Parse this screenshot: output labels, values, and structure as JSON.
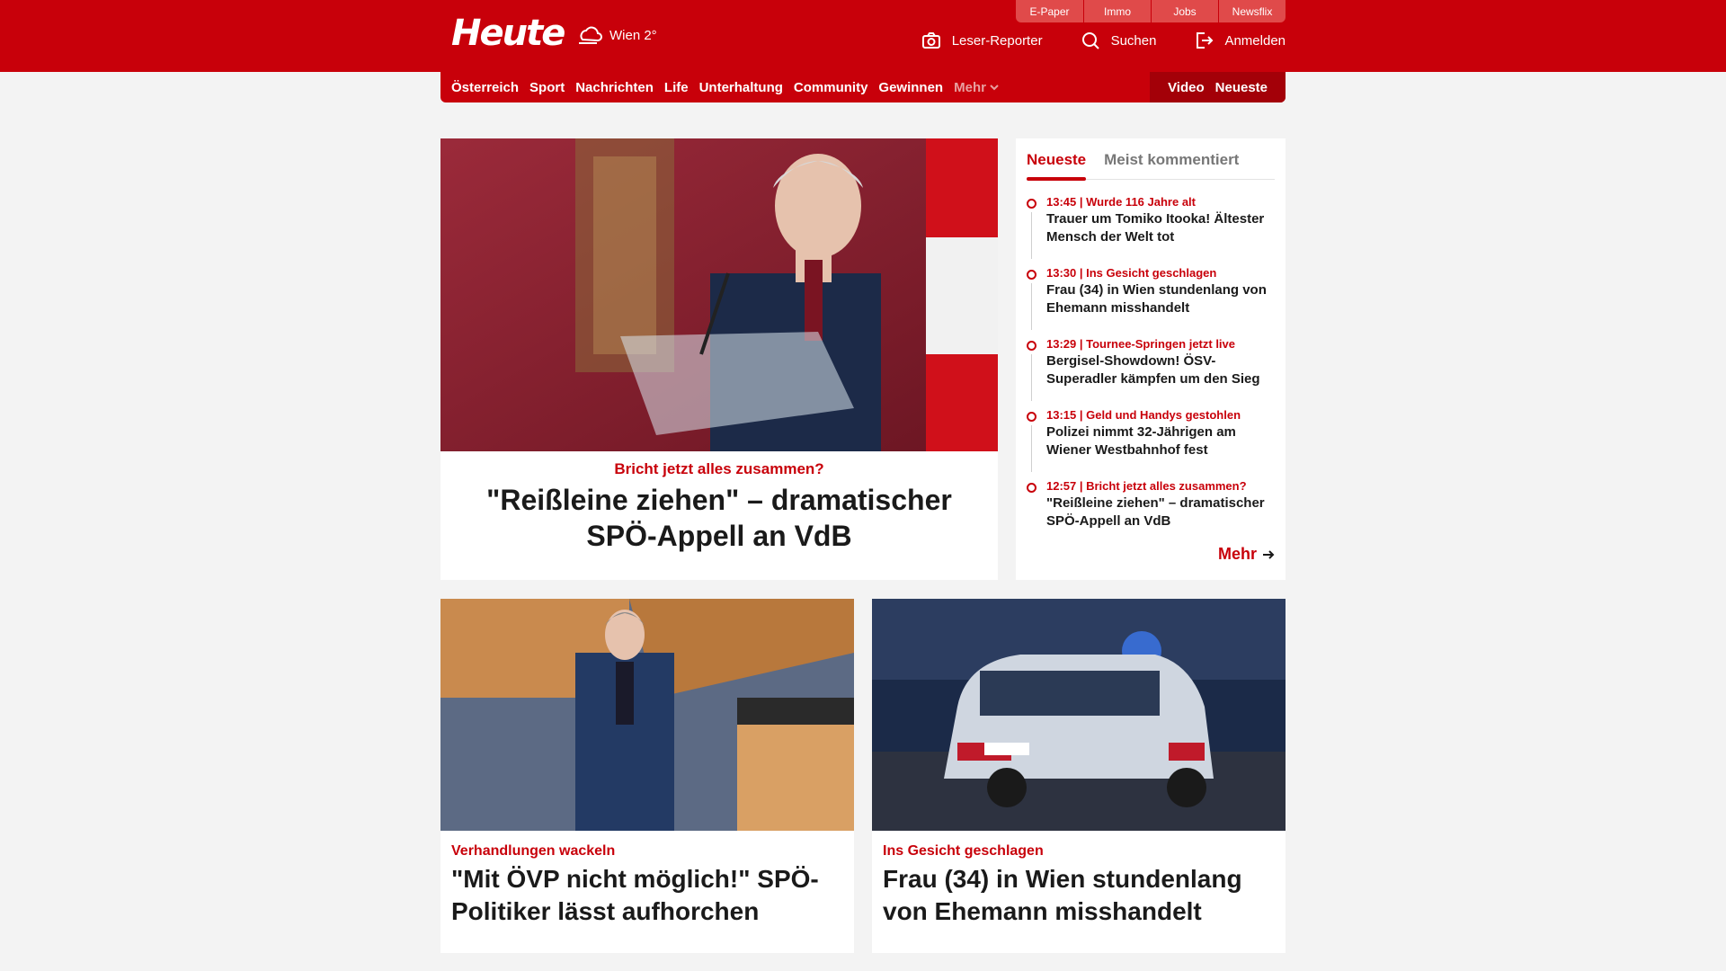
{
  "header": {
    "logo": "Heute",
    "weather": "Wien 2°",
    "services": [
      "E-Paper",
      "Immo",
      "Jobs",
      "Newsflix"
    ],
    "tools": {
      "reporter": "Leser-Reporter",
      "search": "Suchen",
      "login": "Anmelden"
    }
  },
  "nav": {
    "items": [
      "Österreich",
      "Sport",
      "Nachrichten",
      "Life",
      "Unterhaltung",
      "Community",
      "Gewinnen"
    ],
    "more": "Mehr",
    "video": "Video",
    "latest": "Neueste"
  },
  "hero": {
    "kicker": "Bricht jetzt alles zusammen?",
    "title": "\"Reißleine ziehen\" – dramatischer SPÖ-Appell an VdB"
  },
  "sidebar": {
    "tabs": [
      "Neueste",
      "Meist kommentiert"
    ],
    "items": [
      {
        "meta": "13:45 | Wurde 116 Jahre alt",
        "title": "Trauer um Tomiko Itooka! Ältester Mensch der Welt tot"
      },
      {
        "meta": "13:30 | Ins Gesicht geschlagen",
        "title": "Frau (34) in Wien stundenlang von Ehemann misshandelt"
      },
      {
        "meta": "13:29 | Tournee-Springen jetzt live",
        "title": "Bergisel-Showdown! ÖSV-Superadler kämpfen um den Sieg"
      },
      {
        "meta": "13:15 | Geld und Handys gestohlen",
        "title": "Polizei nimmt 32-Jährigen am Wiener Westbahnhof fest"
      },
      {
        "meta": "12:57 | Bricht jetzt alles zusammen?",
        "title": "\"Reißleine ziehen\" – dramatischer SPÖ-Appell an VdB"
      }
    ],
    "more": "Mehr"
  },
  "cards": [
    {
      "kicker": "Verhandlungen wackeln",
      "title": "\"Mit ÖVP nicht möglich!\" SPÖ-Politiker lässt aufhorchen"
    },
    {
      "kicker": "Ins Gesicht geschlagen",
      "title": "Frau (34) in Wien stundenlang von Ehemann misshandelt"
    }
  ],
  "colors": {
    "brand": "#c8000a",
    "background": "#f3f3f3"
  }
}
